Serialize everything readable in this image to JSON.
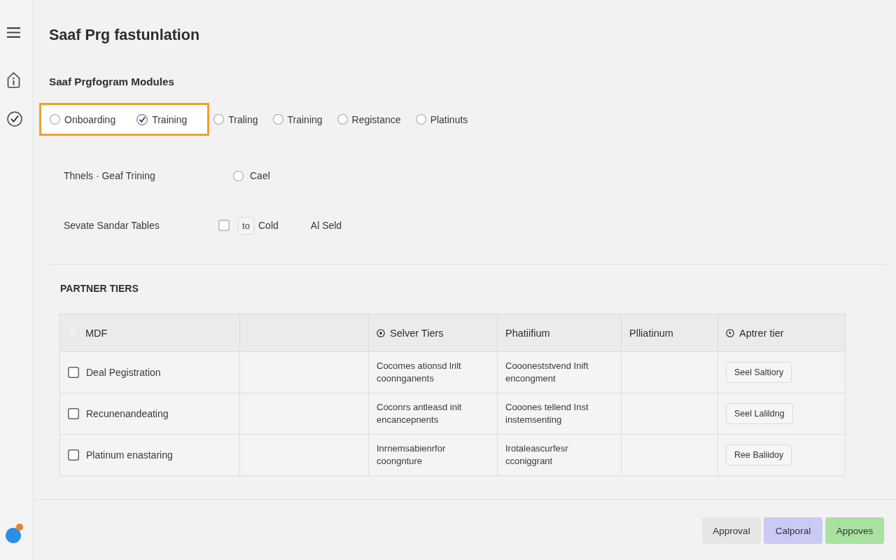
{
  "page": {
    "title": "Saaf Prg fastunlation"
  },
  "modules": {
    "heading": "Saaf Prgfogram Modules",
    "options": [
      {
        "label": "Onboarding",
        "selected": false,
        "highlighted": true
      },
      {
        "label": "Training",
        "selected": true,
        "highlighted": true
      },
      {
        "label": "Traling",
        "selected": false,
        "highlighted": false
      },
      {
        "label": "Training",
        "selected": false,
        "highlighted": false
      },
      {
        "label": "Registance",
        "selected": false,
        "highlighted": false
      },
      {
        "label": "Platinuts",
        "selected": false,
        "highlighted": false
      }
    ]
  },
  "settings": [
    {
      "kind": "radio",
      "label": "Thnels · Geaf Trining",
      "option_label": "Cael",
      "selected": false
    },
    {
      "kind": "checkbox",
      "label": "Sevate Sandar Tables",
      "checked": false,
      "field_value": "to",
      "option_label": "Cold",
      "note": "Al Seld"
    }
  ],
  "partner_tiers": {
    "heading": "PARTNER TIERS",
    "columns": [
      {
        "kind": "radio",
        "label": "MDF",
        "selected": false
      },
      {
        "kind": "empty"
      },
      {
        "kind": "dot-icon",
        "label": "Selver Tiers"
      },
      {
        "kind": "text",
        "label": "Phatiifium"
      },
      {
        "kind": "text",
        "label": "Plliatinum"
      },
      {
        "kind": "clock-icon",
        "label": "Aptrer tier"
      }
    ],
    "rows": [
      {
        "label": "Deal Pegistration",
        "checked": false,
        "column_3": "Cocomes ationsd lrilt coonnganents",
        "column_4": "Coooneststvend Inift encongment",
        "button": "Seel Saltiory"
      },
      {
        "label": "Recunenandeating",
        "checked": false,
        "column_3": "Coconrs antleasd init encancepnents",
        "column_4": "Cooones tellend Inst instemsenting",
        "button": "Seel Lalildng"
      },
      {
        "label": "Platinum enastaring",
        "checked": false,
        "column_3": "Inrnemsabienrfor coongnture",
        "column_4": "Irotaleascurfesr cconiggrant",
        "button": "Ree Baliidoy"
      }
    ]
  },
  "footer_buttons": [
    {
      "label": "Approval",
      "color": "#e6e6e6"
    },
    {
      "label": "Calporal",
      "color": "#c9cbf5"
    },
    {
      "label": "Appoves",
      "color": "#a9e2a0"
    }
  ]
}
